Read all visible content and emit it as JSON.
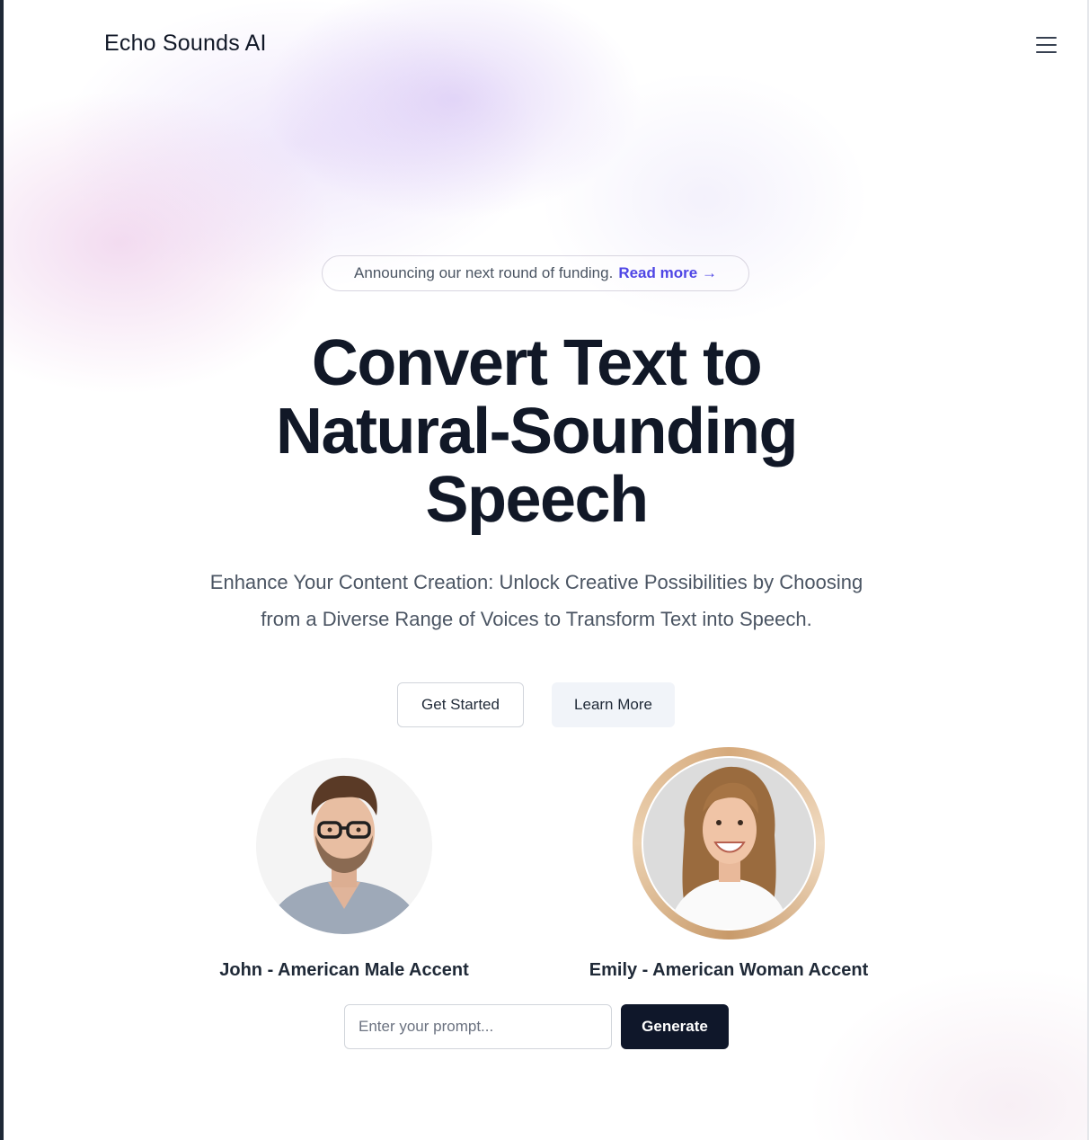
{
  "header": {
    "brand": "Echo Sounds AI",
    "logo_icon": "sound-wave-bars-icon",
    "menu_icon": "hamburger-menu-icon"
  },
  "announcement": {
    "text": "Announcing our next round of funding.",
    "link_label": "Read more",
    "link_arrow": "→"
  },
  "hero": {
    "title_lines": [
      "Convert Text to",
      "Natural-Sounding",
      "Speech"
    ],
    "subtitle_lines": [
      "Enhance Your Content Creation: Unlock Creative Possibilities by Choosing",
      "from a Diverse Range of Voices to Transform Text into Speech."
    ]
  },
  "actions": {
    "get_started": "Get Started",
    "learn_more": "Learn More"
  },
  "voices": [
    {
      "label": "John - American Male Accent",
      "selected": false
    },
    {
      "label": "Emily - American Woman Accent",
      "selected": true
    }
  ],
  "prompt": {
    "value": "",
    "placeholder": "Enter your prompt...",
    "button_label": "Generate"
  },
  "colors": {
    "accent_link": "#4f46e5",
    "primary_button": "#0f172a",
    "heading": "#111827",
    "logo_gradient": [
      "#e11d74",
      "#f97316"
    ],
    "selected_ring": "#d6aa7c"
  }
}
